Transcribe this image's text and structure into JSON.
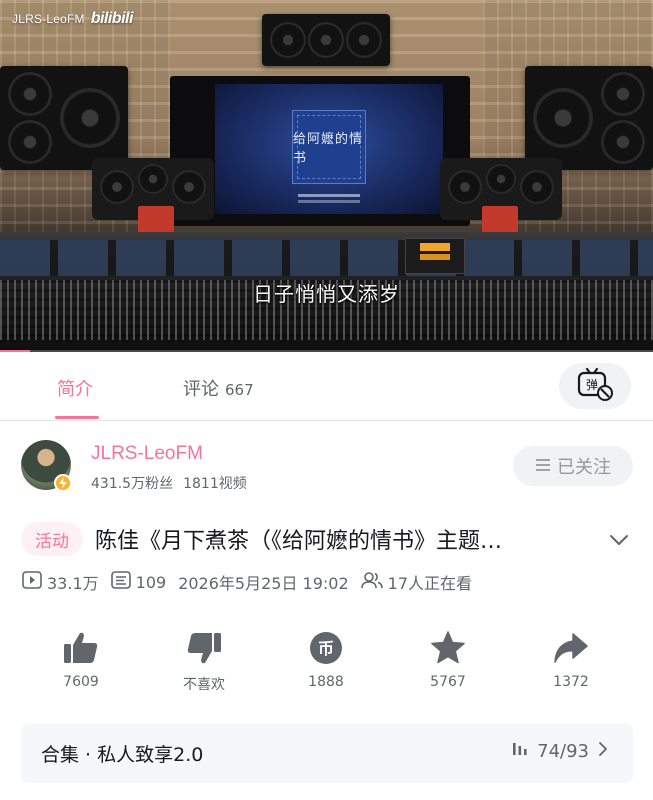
{
  "video": {
    "watermark_user": "JLRS-LeoFM",
    "watermark_logo": "bilibili",
    "subtitle": "日子悄悄又添岁",
    "album_cover_text": "给阿嬷的情书",
    "playback_progress": 0.046
  },
  "tabs": [
    {
      "label": "简介",
      "active": true
    },
    {
      "label": "评论",
      "count": "667",
      "active": false
    }
  ],
  "danmaku_button_icon": "danmaku-off-icon",
  "uploader": {
    "name": "JLRS-LeoFM",
    "followers": "431.5万粉丝",
    "videos": "1811视频",
    "follow_label": "已关注"
  },
  "video_info": {
    "tag": "活动",
    "title": "陈佳《月下煮茶（《给阿嬷的情书》主题…",
    "views": "33.1万",
    "danmaku_count": "109",
    "publish_time": "2026年5月25日 19:02",
    "watching_now": "17人正在看"
  },
  "actions": [
    {
      "icon": "thumbs-up-icon",
      "label": "7609"
    },
    {
      "icon": "thumbs-down-icon",
      "label": "不喜欢"
    },
    {
      "icon": "coin-icon",
      "label": "1888"
    },
    {
      "icon": "star-icon",
      "label": "5767"
    },
    {
      "icon": "share-icon",
      "label": "1372"
    }
  ],
  "collection": {
    "title": "合集 · 私人致享2.0",
    "progress": "74/93"
  },
  "colors": {
    "accent": "#fb7299",
    "text_primary": "#18191c",
    "text_secondary": "#61666d",
    "icon_gray": "#61666d",
    "badge_yellow": "#ffb027"
  }
}
